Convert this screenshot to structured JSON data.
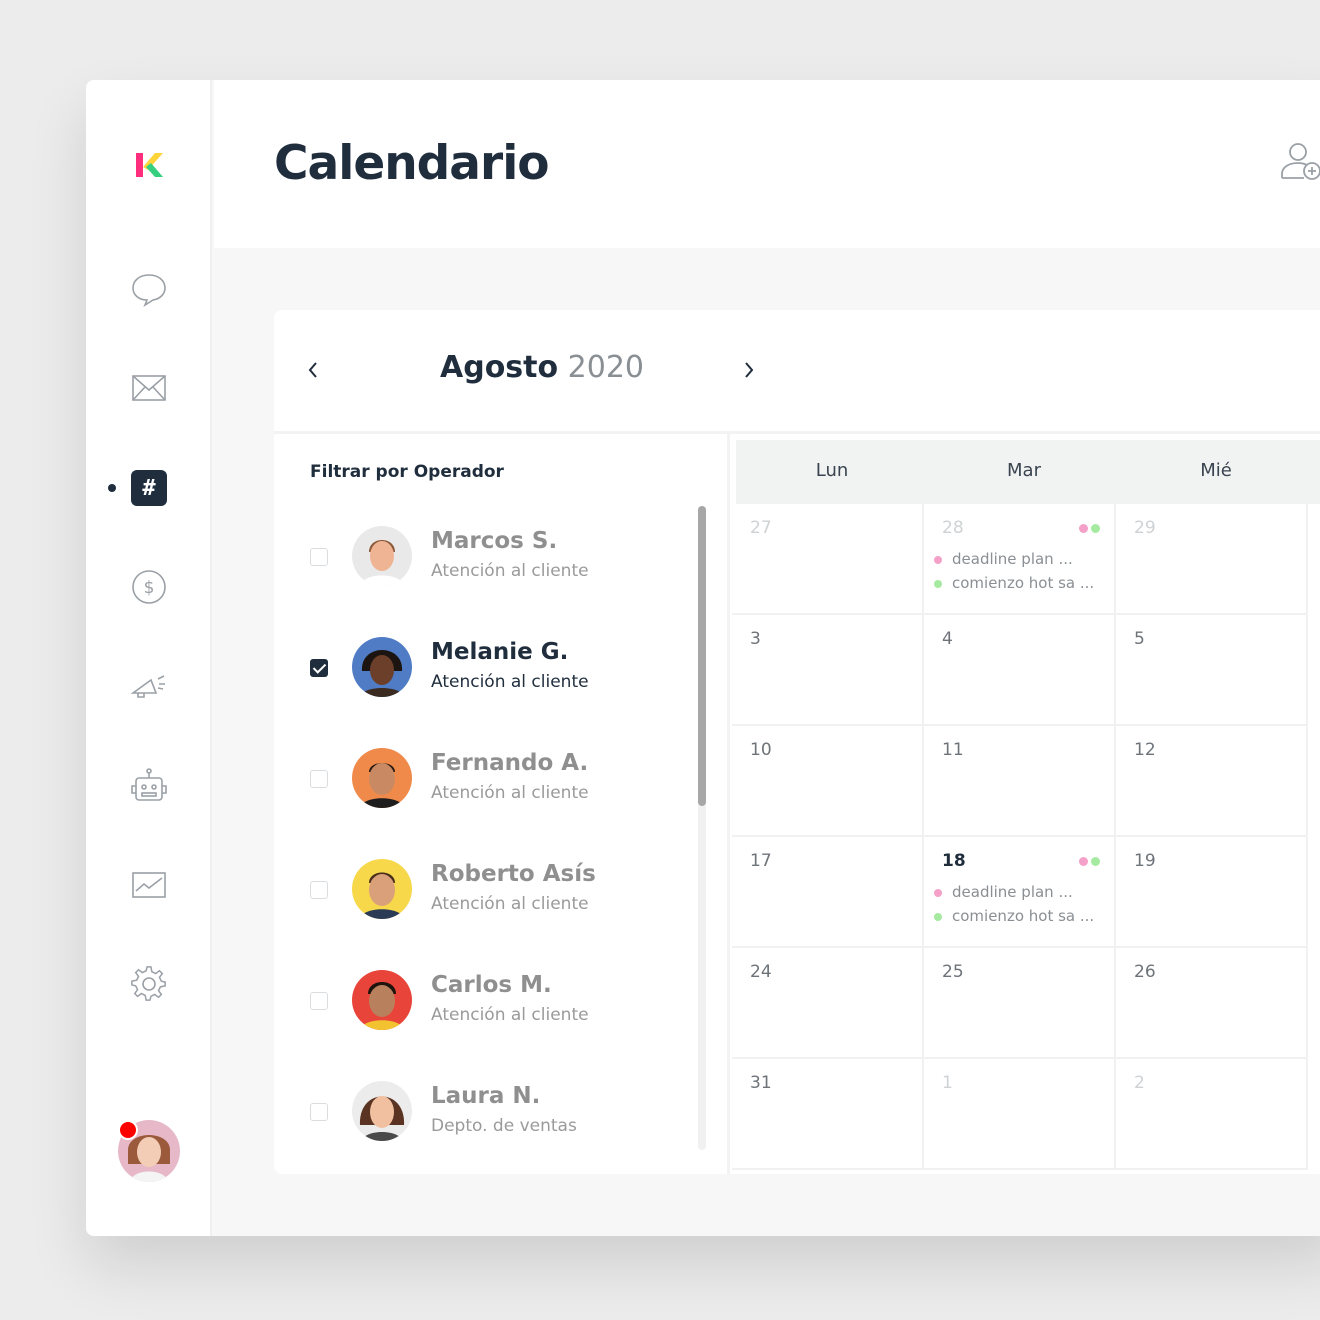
{
  "header": {
    "title": "Calendario"
  },
  "calendar": {
    "month": "Agosto",
    "year": "2020",
    "days_of_week": [
      "Lun",
      "Mar",
      "Mié"
    ],
    "weeks": [
      [
        {
          "day": "27",
          "muted": true,
          "events": []
        },
        {
          "day": "28",
          "muted": true,
          "events": [
            "deadline plan ...",
            "comienzo hot sa ..."
          ]
        },
        {
          "day": "29",
          "muted": true,
          "events": []
        }
      ],
      [
        {
          "day": "3",
          "events": []
        },
        {
          "day": "4",
          "events": []
        },
        {
          "day": "5",
          "events": []
        }
      ],
      [
        {
          "day": "10",
          "events": []
        },
        {
          "day": "11",
          "events": []
        },
        {
          "day": "12",
          "events": []
        }
      ],
      [
        {
          "day": "17",
          "events": []
        },
        {
          "day": "18",
          "today": true,
          "events": [
            "deadline plan ...",
            "comienzo hot sa ..."
          ]
        },
        {
          "day": "19",
          "events": []
        }
      ],
      [
        {
          "day": "24",
          "events": []
        },
        {
          "day": "25",
          "events": []
        },
        {
          "day": "26",
          "events": []
        }
      ],
      [
        {
          "day": "31",
          "events": []
        },
        {
          "day": "1",
          "muted": true,
          "events": []
        },
        {
          "day": "2",
          "muted": true,
          "events": []
        }
      ]
    ]
  },
  "filter": {
    "title": "Filtrar por Operador",
    "operators": [
      {
        "name": "Marcos S.",
        "role": "Atención al cliente",
        "checked": false
      },
      {
        "name": "Melanie G.",
        "role": "Atención al cliente",
        "checked": true
      },
      {
        "name": "Fernando A.",
        "role": "Atención al cliente",
        "checked": false
      },
      {
        "name": "Roberto Asís",
        "role": "Atención al cliente",
        "checked": false
      },
      {
        "name": "Carlos M.",
        "role": "Atención al cliente",
        "checked": false
      },
      {
        "name": "Laura N.",
        "role": "Depto. de ventas",
        "checked": false
      }
    ]
  },
  "sidebar": {
    "items": [
      {
        "icon": "chat-bubble-icon"
      },
      {
        "icon": "mail-icon"
      },
      {
        "icon": "hashtag-icon",
        "active": true,
        "glyph": "#"
      },
      {
        "icon": "dollar-icon"
      },
      {
        "icon": "megaphone-icon"
      },
      {
        "icon": "robot-icon"
      },
      {
        "icon": "chart-icon"
      },
      {
        "icon": "gear-icon"
      }
    ]
  },
  "colors": {
    "primary": "#1f2d3d",
    "event_pink": "#f5a0c8",
    "event_green": "#a6e9a0",
    "notification": "#ff0000"
  }
}
